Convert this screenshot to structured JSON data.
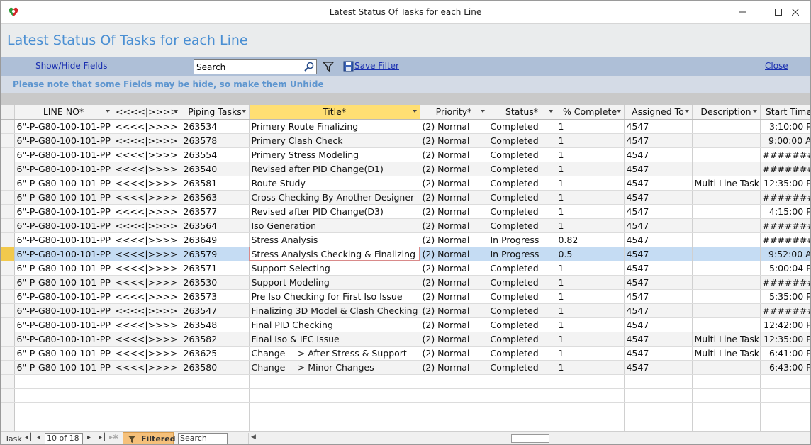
{
  "window": {
    "title": "Latest Status Of Tasks for each Line"
  },
  "form": {
    "title": "Latest Status Of Tasks for each Line"
  },
  "toolbar": {
    "show_hide_label": "Show/Hide Fields",
    "search_value": "Search",
    "save_filter_label": "Save Filter",
    "close_label": "Close"
  },
  "note": "Please note that some Fields may be hide, so make them Unhide",
  "grid": {
    "columns": [
      "LINE NO*",
      "<<<<|>>>>",
      "Piping Tasks",
      "Title*",
      "Priority*",
      "Status*",
      "% Complete",
      "Assigned To",
      "Description",
      "Start Time*"
    ],
    "rows": [
      [
        "6\"-P-G80-100-101-PP",
        "<<<<|>>>>",
        "263534",
        "Primery Route Finalizing",
        "(2) Normal",
        "Completed",
        "1",
        "4547",
        "",
        "3:10:00 PM"
      ],
      [
        "6\"-P-G80-100-101-PP",
        "<<<<|>>>>",
        "263578",
        "Primery Clash Check",
        "(2) Normal",
        "Completed",
        "1",
        "4547",
        "",
        "9:00:00 AM"
      ],
      [
        "6\"-P-G80-100-101-PP",
        "<<<<|>>>>",
        "263554",
        "Primery Stress Modeling",
        "(2) Normal",
        "Completed",
        "1",
        "4547",
        "",
        "##########"
      ],
      [
        "6\"-P-G80-100-101-PP",
        "<<<<|>>>>",
        "263540",
        "Revised after PID Change(D1)",
        "(2) Normal",
        "Completed",
        "1",
        "4547",
        "",
        "##########"
      ],
      [
        "6\"-P-G80-100-101-PP",
        "<<<<|>>>>",
        "263581",
        "Route Study",
        "(2) Normal",
        "Completed",
        "1",
        "4547",
        "Multi Line Task",
        "12:35:00 PM"
      ],
      [
        "6\"-P-G80-100-101-PP",
        "<<<<|>>>>",
        "263563",
        "Cross Checking By Another Designer",
        "(2) Normal",
        "Completed",
        "1",
        "4547",
        "",
        "##########"
      ],
      [
        "6\"-P-G80-100-101-PP",
        "<<<<|>>>>",
        "263577",
        "Revised after PID Change(D3)",
        "(2) Normal",
        "Completed",
        "1",
        "4547",
        "",
        "4:15:00 PM"
      ],
      [
        "6\"-P-G80-100-101-PP",
        "<<<<|>>>>",
        "263564",
        "Iso Generation",
        "(2) Normal",
        "Completed",
        "1",
        "4547",
        "",
        "##########"
      ],
      [
        "6\"-P-G80-100-101-PP",
        "<<<<|>>>>",
        "263649",
        "Stress Analysis",
        "(2) Normal",
        "In Progress",
        "0.82",
        "4547",
        "",
        "##########"
      ],
      [
        "6\"-P-G80-100-101-PP",
        "<<<<|>>>>",
        "263579",
        "Stress Analysis Checking & Finalizing",
        "(2) Normal",
        "In Progress",
        "0.5",
        "4547",
        "",
        "9:52:00 AM"
      ],
      [
        "6\"-P-G80-100-101-PP",
        "<<<<|>>>>",
        "263571",
        "Support Selecting",
        "(2) Normal",
        "Completed",
        "1",
        "4547",
        "",
        "5:00:04 PM"
      ],
      [
        "6\"-P-G80-100-101-PP",
        "<<<<|>>>>",
        "263530",
        "Support Modeling",
        "(2) Normal",
        "Completed",
        "1",
        "4547",
        "",
        "##########"
      ],
      [
        "6\"-P-G80-100-101-PP",
        "<<<<|>>>>",
        "263573",
        "Pre Iso Checking for First Iso Issue",
        "(2) Normal",
        "Completed",
        "1",
        "4547",
        "",
        "5:35:00 PM"
      ],
      [
        "6\"-P-G80-100-101-PP",
        "<<<<|>>>>",
        "263547",
        "Finalizing 3D Model & Clash Checking",
        "(2) Normal",
        "Completed",
        "1",
        "4547",
        "",
        "##########"
      ],
      [
        "6\"-P-G80-100-101-PP",
        "<<<<|>>>>",
        "263548",
        "Final PID Checking",
        "(2) Normal",
        "Completed",
        "1",
        "4547",
        "",
        "12:42:00 PM"
      ],
      [
        "6\"-P-G80-100-101-PP",
        "<<<<|>>>>",
        "263582",
        "Final Iso & IFC Issue",
        "(2) Normal",
        "Completed",
        "1",
        "4547",
        "Multi Line Task",
        "12:35:00 PM"
      ],
      [
        "6\"-P-G80-100-101-PP",
        "<<<<|>>>>",
        "263625",
        "Change ---> After Stress & Support",
        "(2) Normal",
        "Completed",
        "1",
        "4547",
        "Multi Line Task",
        "6:41:00 PM"
      ],
      [
        "6\"-P-G80-100-101-PP",
        "<<<<|>>>>",
        "263580",
        "Change ---> Minor Changes",
        "(2) Normal",
        "Completed",
        "1",
        "4547",
        "",
        "6:43:00 PM"
      ]
    ],
    "current_row": 9
  },
  "statusbar": {
    "record_label": "Task",
    "record_position": "10 of 18",
    "filtered_label": "Filtered",
    "search_value": "Search"
  },
  "colors": {
    "form_title": "#4a8fd3",
    "toolbar_bg": "#aebfd7",
    "selected_header": "#ffdf73",
    "current_row": "#c5dcf3"
  }
}
